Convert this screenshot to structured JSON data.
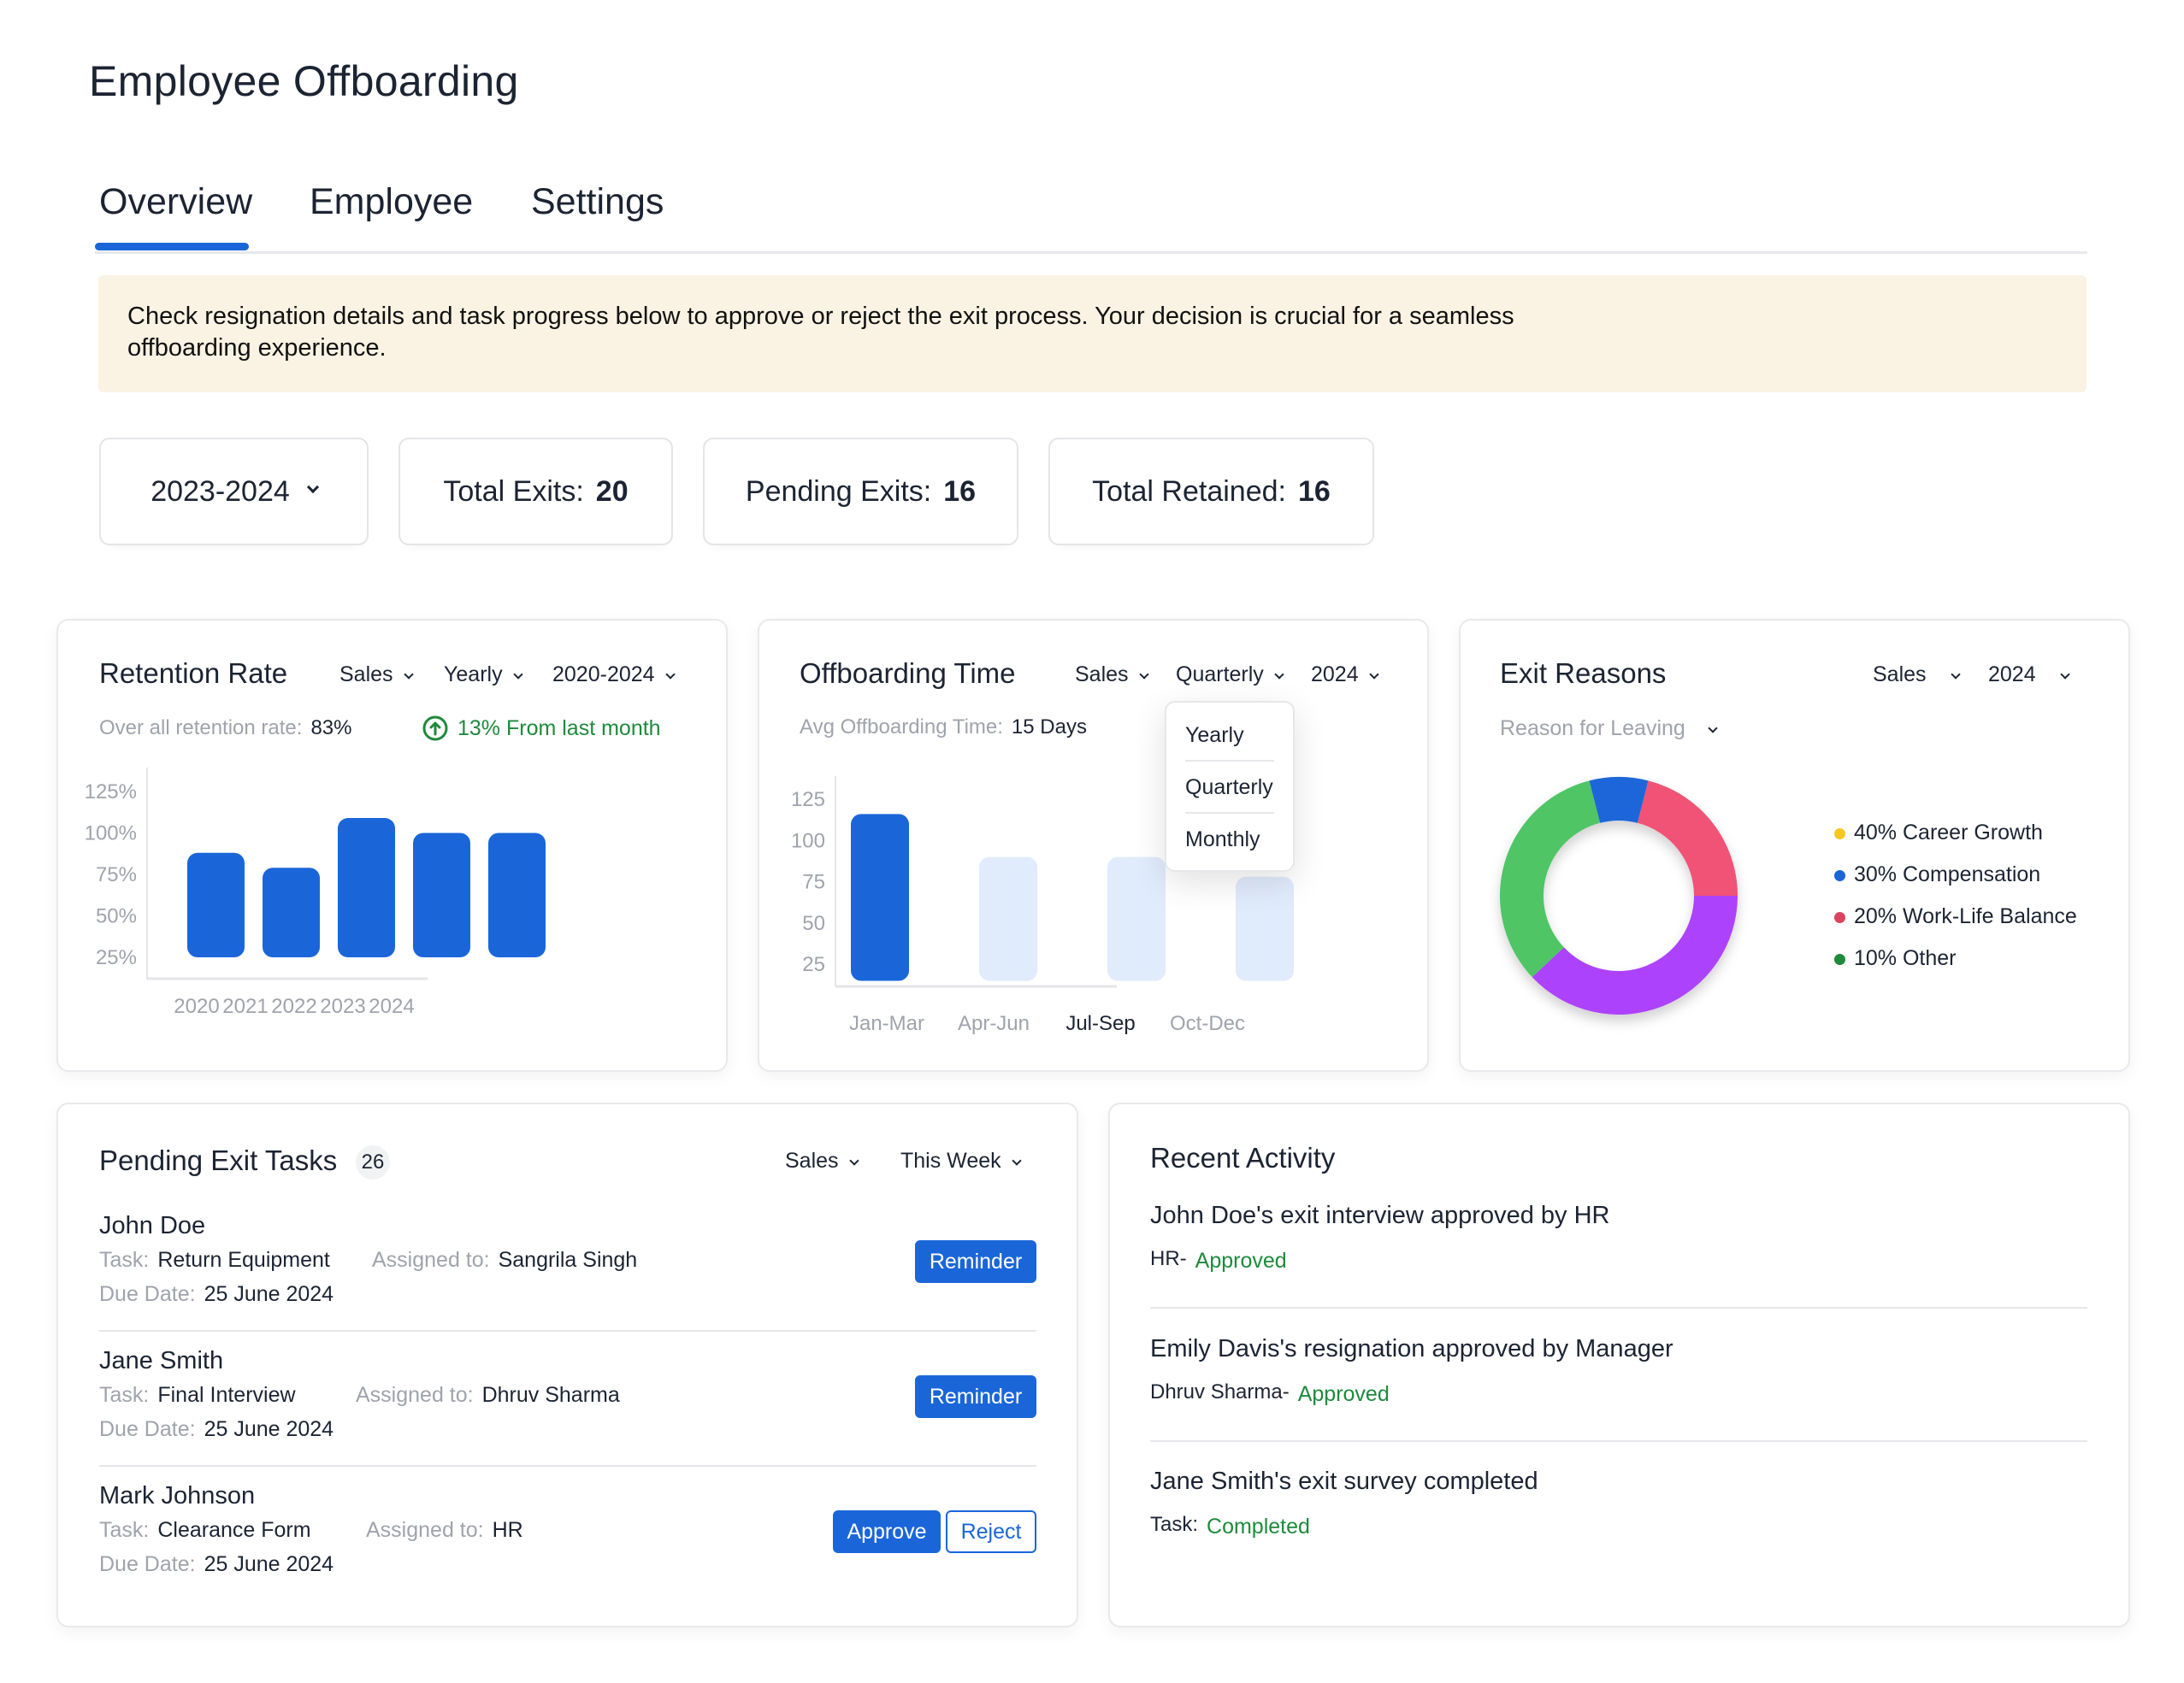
{
  "page": {
    "title": "Employee Offboarding"
  },
  "tabs": [
    {
      "label": "Overview",
      "active": true
    },
    {
      "label": "Employee",
      "active": false
    },
    {
      "label": "Settings",
      "active": false
    }
  ],
  "banner": {
    "text": "Check resignation details and task progress below to approve or reject the exit process. Your decision is crucial for a seamless offboarding experience."
  },
  "stats": {
    "year_select": "2023-2024",
    "total_exits_label": "Total Exits:",
    "total_exits_value": "20",
    "pending_exits_label": "Pending Exits:",
    "pending_exits_value": "16",
    "total_retained_label": "Total Retained:",
    "total_retained_value": "16"
  },
  "colors": {
    "accent": "#1a66d9",
    "accent_light": "#e0ebfb",
    "success": "#1e8a3c",
    "banner_bg": "#faf2e2"
  },
  "retention": {
    "title": "Retention Rate",
    "filters": [
      "Sales",
      "Yearly",
      "2020-2024"
    ],
    "overall_label": "Over all retention rate:",
    "overall_value": "83%",
    "trend_text": "13% From last month",
    "trend_icon": "arrow-up-circle-icon"
  },
  "offboarding": {
    "title": "Offboarding Time",
    "filters": [
      "Sales",
      "Quarterly",
      "2024"
    ],
    "avg_label": "Avg Offboarding Time:",
    "avg_value": "15 Days",
    "menu_options": [
      "Yearly",
      "Quarterly",
      "Monthly"
    ]
  },
  "exit_reasons": {
    "title": "Exit Reasons",
    "filters": [
      "Sales",
      "2024"
    ],
    "reason_select": "Reason for Leaving"
  },
  "chart_data": [
    {
      "type": "bar",
      "title": "Retention Rate",
      "categories": [
        "2020",
        "2021",
        "2022",
        "2023",
        "2024"
      ],
      "values": [
        88,
        79,
        109,
        100,
        100
      ],
      "baseline": 25,
      "yticks": [
        "125%",
        "100%",
        "75%",
        "50%",
        "25%"
      ],
      "ytick_values": [
        125,
        100,
        75,
        50,
        25
      ],
      "ylim": [
        25,
        125
      ],
      "color": "#1a66d9",
      "xlabel": "",
      "ylabel": ""
    },
    {
      "type": "bar",
      "title": "Offboarding Time",
      "categories": [
        "Jan-Mar",
        "Apr-Jun",
        "Jul-Sep",
        "Oct-Dec"
      ],
      "values": [
        116,
        90,
        90,
        78
      ],
      "baseline": 15,
      "highlighted": "Jan-Mar",
      "active_label": "Jul-Sep",
      "yticks": [
        "125",
        "100",
        "75",
        "50",
        "25"
      ],
      "ytick_values": [
        125,
        100,
        75,
        50,
        25
      ],
      "ylim": [
        15,
        125
      ],
      "xlabel": "",
      "ylabel": ""
    },
    {
      "type": "pie",
      "title": "Exit Reasons",
      "legend": [
        {
          "label": "40% Career Growth",
          "color": "#f9c623"
        },
        {
          "label": "30% Compensation",
          "color": "#1a66d9"
        },
        {
          "label": "20% Work-Life Balance",
          "color": "#d9455f"
        },
        {
          "label": "10% Other",
          "color": "#1e8a3c"
        }
      ],
      "slices": [
        {
          "color": "#1a66d9",
          "value": 8
        },
        {
          "color": "#f05275",
          "value": 21
        },
        {
          "color": "#ad42fd",
          "value": 38
        },
        {
          "color": "#4fc566",
          "value": 33
        }
      ],
      "legend_position": "right"
    }
  ],
  "pending_tasks": {
    "title": "Pending Exit Tasks",
    "count": "26",
    "filters": [
      "Sales",
      "This Week"
    ],
    "task_label": "Task:",
    "assigned_label": "Assigned to:",
    "due_label": "Due Date:",
    "items": [
      {
        "name": "John Doe",
        "task": "Return Equipment",
        "assigned": "Sangrila Singh",
        "due": "25 June 2024",
        "actions": [
          "Reminder"
        ]
      },
      {
        "name": "Jane Smith",
        "task": "Final Interview",
        "assigned": "Dhruv Sharma",
        "due": "25 June 2024",
        "actions": [
          "Reminder"
        ]
      },
      {
        "name": "Mark Johnson",
        "task": "Clearance Form",
        "assigned": "HR",
        "due": "25 June 2024",
        "actions": [
          "Approve",
          "Reject"
        ]
      }
    ]
  },
  "recent_activity": {
    "title": "Recent Activity",
    "items": [
      {
        "text": "John Doe's exit interview approved by HR",
        "by": "HR-",
        "status": "Approved"
      },
      {
        "text": "Emily Davis's resignation approved by Manager",
        "by": "Dhruv Sharma-",
        "status": "Approved"
      },
      {
        "text": "Jane Smith's exit survey completed",
        "by": "Task:",
        "status": "Completed"
      }
    ]
  }
}
